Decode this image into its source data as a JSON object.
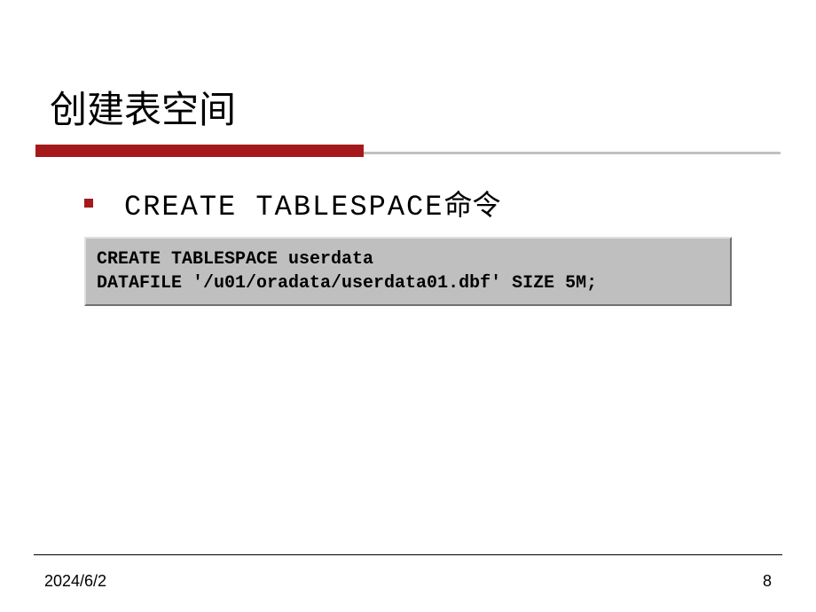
{
  "title": "创建表空间",
  "bullet": {
    "command_text": "CREATE TABLESPACE",
    "command_suffix": "命令"
  },
  "code": "CREATE TABLESPACE userdata\nDATAFILE '/u01/oradata/userdata01.dbf' SIZE 5M;",
  "footer": {
    "date": "2024/6/2",
    "page": "8"
  }
}
